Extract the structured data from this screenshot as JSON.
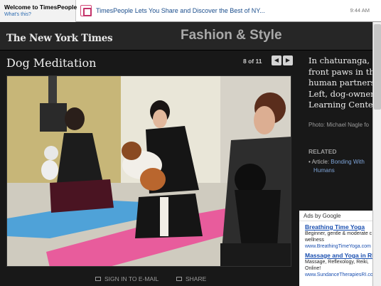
{
  "notification": {
    "title": "Welcome to TimesPeople",
    "subtitle": "What's this?",
    "message": "TimesPeople Lets You Share and Discover the Best of NY...",
    "time": "9:44 AM"
  },
  "masthead": {
    "logo": "The New York Times",
    "section": "Fashion & Style"
  },
  "slideshow": {
    "title": "Dog Meditation",
    "counter": "8 of 11",
    "prev_label": "◀",
    "next_label": "▶"
  },
  "caption": {
    "lines": [
      "In chaturanga, d",
      "front paws in th",
      "human partners",
      "Left, dog-owner",
      "Learning Cente"
    ],
    "credit": "Photo: Michael Nagle fo"
  },
  "related": {
    "heading": "RELATED",
    "bullet": "•",
    "prefix": "Article: ",
    "link_line1": "Bonding With",
    "link_line2": "Humans"
  },
  "utilities": {
    "email": "SIGN IN TO E-MAIL",
    "share": "SHARE"
  },
  "ads": {
    "heading": "Ads by Google",
    "items": [
      {
        "title": "Breathing Time Yoga",
        "line1": "Beginner, gentle & moderate c",
        "line2": "wellness",
        "url": "www.BreathingTimeYoga.com"
      },
      {
        "title": "Massage and Yoga in RI",
        "line1": "Massage, Reflexology, Reiki, ",
        "line2": "Online!",
        "url": "www.SundanceTherapiesRI.co"
      }
    ]
  },
  "colors": {
    "page_bg": "#181818",
    "masthead_bg": "#262626",
    "link": "#1a4fb0",
    "mat_blue": "#4fa2d8",
    "mat_pink": "#e85c9c"
  }
}
